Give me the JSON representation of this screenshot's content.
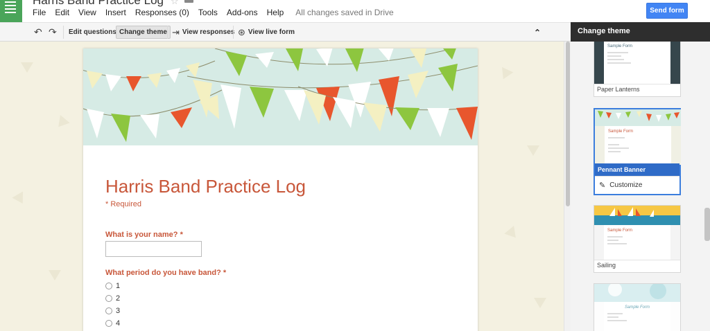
{
  "header": {
    "doc_title": "Harris Band Practice Log",
    "menu": [
      "File",
      "Edit",
      "View",
      "Insert",
      "Responses (0)",
      "Tools",
      "Add-ons",
      "Help"
    ],
    "save_status": "All changes saved in Drive",
    "send_button": "Send form"
  },
  "toolbar": {
    "edit_questions": "Edit questions",
    "change_theme": "Change theme",
    "view_responses": "View responses",
    "view_live_form": "View live form"
  },
  "form": {
    "title": "Harris Band Practice Log",
    "required_note": "* Required",
    "q1_label": "What is your name? *",
    "q2_label": "What period do you have band? *",
    "q2_options": [
      "1",
      "2",
      "3",
      "4"
    ]
  },
  "theme_panel": {
    "title": "Change theme",
    "themes": [
      {
        "name": "Paper Lanterns"
      },
      {
        "name": "Pennant Banner",
        "selected": true
      },
      {
        "name": "Sailing"
      },
      {
        "name": ""
      }
    ],
    "customize_label": "Customize",
    "mini_form_title": "Sample Form"
  },
  "colors": {
    "accent": "#c8573a",
    "send_button": "#4285f4",
    "app_tile": "#4aa55a",
    "selected_theme": "#2f6bc7",
    "canvas_bg": "#f4f1e1",
    "banner_bg": "#d6ebe5"
  },
  "icons": [
    "menu-icon",
    "star-icon",
    "folder-icon",
    "undo-icon",
    "redo-icon",
    "view-responses-icon",
    "view-live-form-icon",
    "collapse-icon",
    "pencil-icon"
  ]
}
